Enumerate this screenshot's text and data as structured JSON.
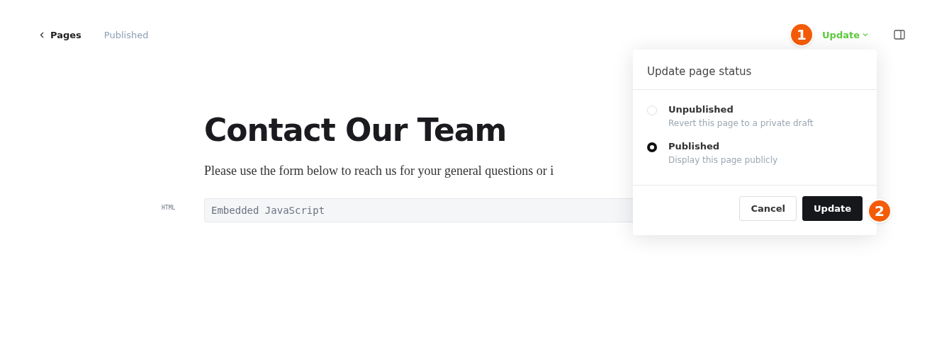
{
  "breadcrumb": {
    "back_label": "Pages",
    "status": "Published"
  },
  "update_menu": {
    "label": "Update",
    "expanded": true
  },
  "popover": {
    "title": "Update page status",
    "options": [
      {
        "label": "Unpublished",
        "description": "Revert this page to a private draft",
        "selected": false
      },
      {
        "label": "Published",
        "description": "Display this page publicly",
        "selected": true
      }
    ],
    "buttons": [
      {
        "label": "Cancel",
        "kind": "secondary"
      },
      {
        "label": "Update",
        "kind": "primary"
      }
    ]
  },
  "callouts": [
    "1",
    "2"
  ],
  "page": {
    "heading": "Contact Our Team",
    "paragraph": "Please use the form below to reach us for your general questions or i",
    "block": {
      "type_label": "HTML",
      "placeholder": "Embedded JavaScript"
    }
  }
}
